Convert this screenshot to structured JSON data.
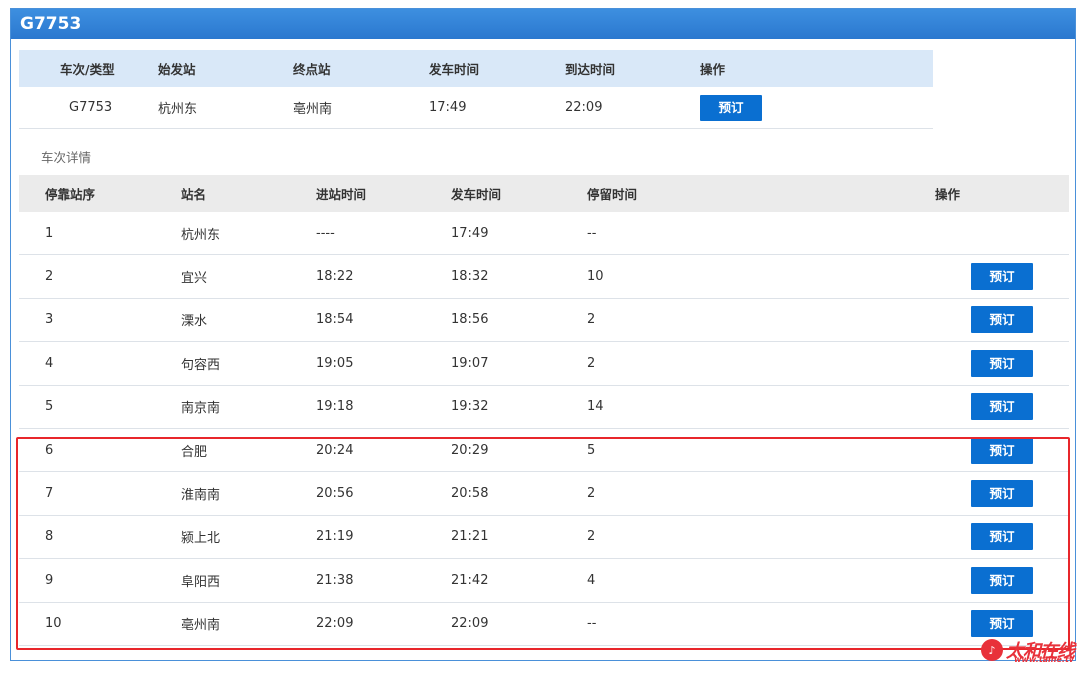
{
  "title": "G7753",
  "summary": {
    "headers": [
      "车次/类型",
      "始发站",
      "终点站",
      "发车时间",
      "到达时间",
      "操作"
    ],
    "row": {
      "train": "G7753",
      "from": "杭州东",
      "to": "亳州南",
      "depart": "17:49",
      "arrive": "22:09",
      "action": "预订"
    }
  },
  "details_label": "车次详情",
  "detail": {
    "headers": [
      "停靠站序",
      "站名",
      "进站时间",
      "发车时间",
      "停留时间",
      "操作"
    ],
    "rows": [
      {
        "seq": "1",
        "station": "杭州东",
        "arrive": "----",
        "depart": "17:49",
        "stay": "--",
        "action": ""
      },
      {
        "seq": "2",
        "station": "宜兴",
        "arrive": "18:22",
        "depart": "18:32",
        "stay": "10",
        "action": "预订"
      },
      {
        "seq": "3",
        "station": "溧水",
        "arrive": "18:54",
        "depart": "18:56",
        "stay": "2",
        "action": "预订"
      },
      {
        "seq": "4",
        "station": "句容西",
        "arrive": "19:05",
        "depart": "19:07",
        "stay": "2",
        "action": "预订"
      },
      {
        "seq": "5",
        "station": "南京南",
        "arrive": "19:18",
        "depart": "19:32",
        "stay": "14",
        "action": "预订"
      },
      {
        "seq": "6",
        "station": "合肥",
        "arrive": "20:24",
        "depart": "20:29",
        "stay": "5",
        "action": "预订"
      },
      {
        "seq": "7",
        "station": "淮南南",
        "arrive": "20:56",
        "depart": "20:58",
        "stay": "2",
        "action": "预订"
      },
      {
        "seq": "8",
        "station": "颍上北",
        "arrive": "21:19",
        "depart": "21:21",
        "stay": "2",
        "action": "预订"
      },
      {
        "seq": "9",
        "station": "阜阳西",
        "arrive": "21:38",
        "depart": "21:42",
        "stay": "4",
        "action": "预订"
      },
      {
        "seq": "10",
        "station": "亳州南",
        "arrive": "22:09",
        "depart": "22:09",
        "stay": "--",
        "action": "预订"
      }
    ]
  },
  "watermark": {
    "text": "太和在线",
    "url": "www.taihe.tv"
  },
  "colors": {
    "title_bar": "#2b78cf",
    "button": "#0a6fd1",
    "highlight": "#e8262b",
    "summary_header": "#d9e8f8",
    "detail_header": "#ebebeb"
  }
}
